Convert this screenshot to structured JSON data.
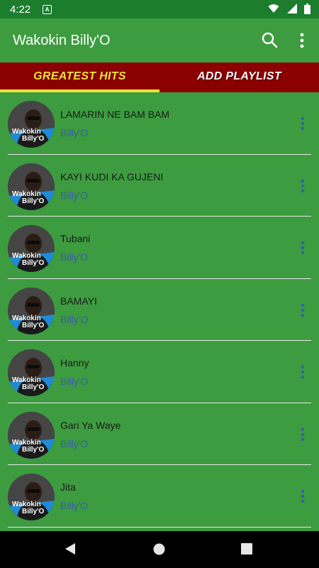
{
  "status_bar": {
    "time": "4:22",
    "a_glyph": "A",
    "icons": [
      "wifi-icon",
      "cell-signal-icon",
      "battery-icon"
    ]
  },
  "app_bar": {
    "title": "Wakokin Billy'O",
    "icons": [
      "search-icon",
      "more-vert-icon"
    ]
  },
  "tabs": [
    {
      "label": "GREATEST HITS",
      "selected": true
    },
    {
      "label": "ADD PLAYLIST",
      "selected": false
    }
  ],
  "avatar_text": {
    "line1": "Wakokin",
    "line2": "Billy'O"
  },
  "songs": [
    {
      "title": "LAMARIN NE BAM BAM",
      "artist": "Billy'O"
    },
    {
      "title": "KAYI KUDI KA GUJENI",
      "artist": "Billy'O"
    },
    {
      "title": "Tubani",
      "artist": "Billy'O"
    },
    {
      "title": "BAMAYI",
      "artist": "Billy'O"
    },
    {
      "title": "Hanny",
      "artist": "Billy'O"
    },
    {
      "title": "Gari Ya Waye",
      "artist": "Billy'O"
    },
    {
      "title": "Jita",
      "artist": "Billy'O"
    }
  ],
  "colors": {
    "background": "#3d9c3f",
    "status_bar": "#1c7d2c",
    "tab_bar": "#8b0000",
    "tab_selected": "#f7e23a",
    "artist_text": "#3a5bb0"
  },
  "nav_bar": {
    "icons": [
      "back-icon",
      "home-icon",
      "recents-icon"
    ]
  }
}
